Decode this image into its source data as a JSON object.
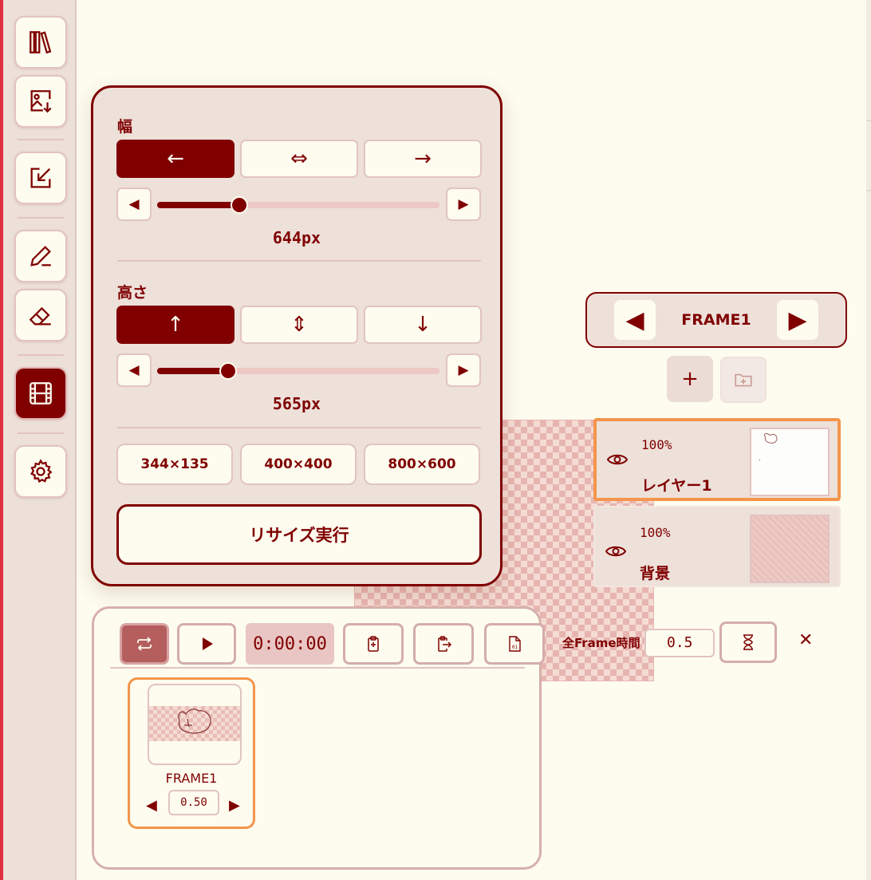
{
  "toolbar": {
    "tools": [
      {
        "icon": "library-icon"
      },
      {
        "icon": "image-import-icon"
      },
      {
        "icon": "external-link-icon"
      },
      {
        "icon": "pen-icon"
      },
      {
        "icon": "eraser-icon"
      },
      {
        "icon": "film-icon",
        "active": true
      },
      {
        "icon": "gear-icon"
      }
    ]
  },
  "resize_panel": {
    "width_label": "幅",
    "width_anchors": [
      "←",
      "⇔",
      "→"
    ],
    "width_value": "644px",
    "width_slider_fraction": 0.29,
    "height_label": "高さ",
    "height_anchors": [
      "↑",
      "⇕",
      "↓"
    ],
    "height_value": "565px",
    "height_slider_fraction": 0.25,
    "step_left": "◀",
    "step_right": "▶",
    "presets": [
      "344×135",
      "400×400",
      "800×600"
    ],
    "execute_label": "リサイズ実行"
  },
  "frame_nav": {
    "prev": "◀",
    "next": "▶",
    "current": "FRAME1"
  },
  "layer_actions": {
    "add_label": "+"
  },
  "layers": [
    {
      "opacity": "100%",
      "name": "レイヤー1",
      "active": true
    },
    {
      "opacity": "100%",
      "name": "背景",
      "active": false
    }
  ],
  "timeline": {
    "timecode": "0:00:00",
    "frames": [
      {
        "name": "FRAME1",
        "duration": "0.50",
        "prev": "◀",
        "next": "▶"
      }
    ],
    "all_frame_label": "全Frame時間",
    "all_frame_value": "0.5",
    "close": "✕"
  },
  "colors": {
    "accent": "#800000",
    "background": "#fdfcef",
    "panel": "#ede1da",
    "highlight": "#f4954b"
  }
}
